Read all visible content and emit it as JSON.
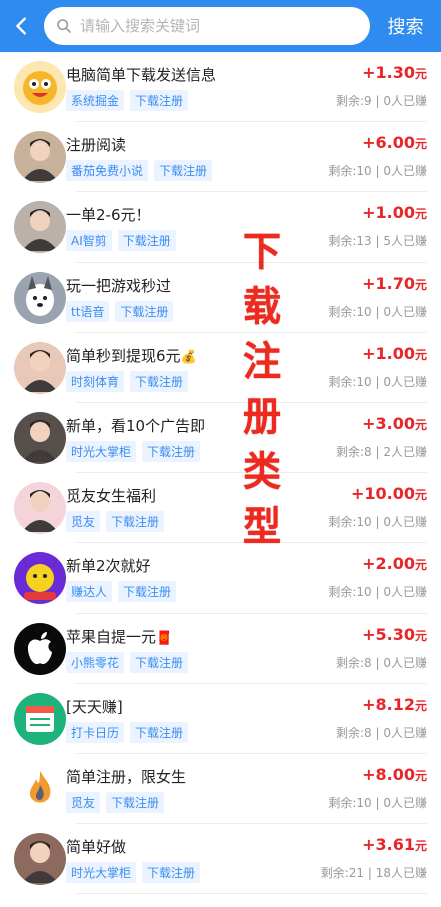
{
  "header": {
    "search_placeholder": "请输入搜索关键词",
    "search_button": "搜索"
  },
  "watermark": "下\n载\n注\n册\n类\n型",
  "items": [
    {
      "title": "电脑简单下载发送信息",
      "tags": [
        "系统掘金",
        "下载注册"
      ],
      "price": "+1.30",
      "unit": "元",
      "stats": "剩余:9 | 0人已赚",
      "avatar": {
        "bg": "#fde7b0",
        "icon": "cat-face"
      }
    },
    {
      "title": "注册阅读",
      "tags": [
        "番茄免费小说",
        "下载注册"
      ],
      "price": "+6.00",
      "unit": "元",
      "stats": "剩余:10 | 0人已赚",
      "avatar": {
        "bg": "#c9b29a",
        "icon": "portrait"
      }
    },
    {
      "title": "一单2-6元！",
      "tags": [
        "AI智剪",
        "下载注册"
      ],
      "price": "+1.00",
      "unit": "元",
      "stats": "剩余:13 | 5人已赚",
      "avatar": {
        "bg": "#b9b1aa",
        "icon": "portrait"
      }
    },
    {
      "title": "玩一把游戏秒过",
      "tags": [
        "tt语音",
        "下载注册"
      ],
      "price": "+1.70",
      "unit": "元",
      "stats": "剩余:10 | 0人已赚",
      "avatar": {
        "bg": "#9aa4b0",
        "icon": "dog"
      }
    },
    {
      "title": "简单秒到提现6元",
      "title_emoji": "💰",
      "tags": [
        "时刻体育",
        "下载注册"
      ],
      "price": "+1.00",
      "unit": "元",
      "stats": "剩余:10 | 0人已赚",
      "avatar": {
        "bg": "#e8c8b8",
        "icon": "portrait"
      }
    },
    {
      "title": "新单，看10个广告即",
      "tags": [
        "时光大掌柜",
        "下载注册"
      ],
      "price": "+3.00",
      "unit": "元",
      "stats": "剩余:8 | 2人已赚",
      "avatar": {
        "bg": "#55504c",
        "icon": "portrait"
      }
    },
    {
      "title": "觅友女生福利",
      "tags": [
        "觅友",
        "下载注册"
      ],
      "price": "+10.00",
      "unit": "元",
      "stats": "剩余:10 | 0人已赚",
      "avatar": {
        "bg": "#f3d4da",
        "icon": "portrait"
      }
    },
    {
      "title": "新单2次就好",
      "tags": [
        "赚达人",
        "下载注册"
      ],
      "price": "+2.00",
      "unit": "元",
      "stats": "剩余:10 | 0人已赚",
      "avatar": {
        "bg": "#6a2bd6",
        "icon": "mascot"
      }
    },
    {
      "title": "苹果自提一元",
      "title_emoji": "🧧",
      "tags": [
        "小熊零花",
        "下载注册"
      ],
      "price": "+5.30",
      "unit": "元",
      "stats": "剩余:8 | 0人已赚",
      "avatar": {
        "bg": "#0a0a0a",
        "icon": "apple"
      }
    },
    {
      "title": "[天天赚]",
      "tags": [
        "打卡日历",
        "下载注册"
      ],
      "price": "+8.12",
      "unit": "元",
      "stats": "剩余:8 | 0人已赚",
      "avatar": {
        "bg": "#1db37a",
        "icon": "calendar"
      }
    },
    {
      "title": "简单注册，限女生",
      "tags": [
        "觅友",
        "下载注册"
      ],
      "price": "+8.00",
      "unit": "元",
      "stats": "剩余:10 | 0人已赚",
      "avatar": {
        "bg": "#ffffff",
        "icon": "flame"
      }
    },
    {
      "title": "简单好做",
      "tags": [
        "时光大掌柜",
        "下载注册"
      ],
      "price": "+3.61",
      "unit": "元",
      "stats": "剩余:21 | 18人已赚",
      "avatar": {
        "bg": "#8c6b5e",
        "icon": "portrait"
      }
    }
  ]
}
